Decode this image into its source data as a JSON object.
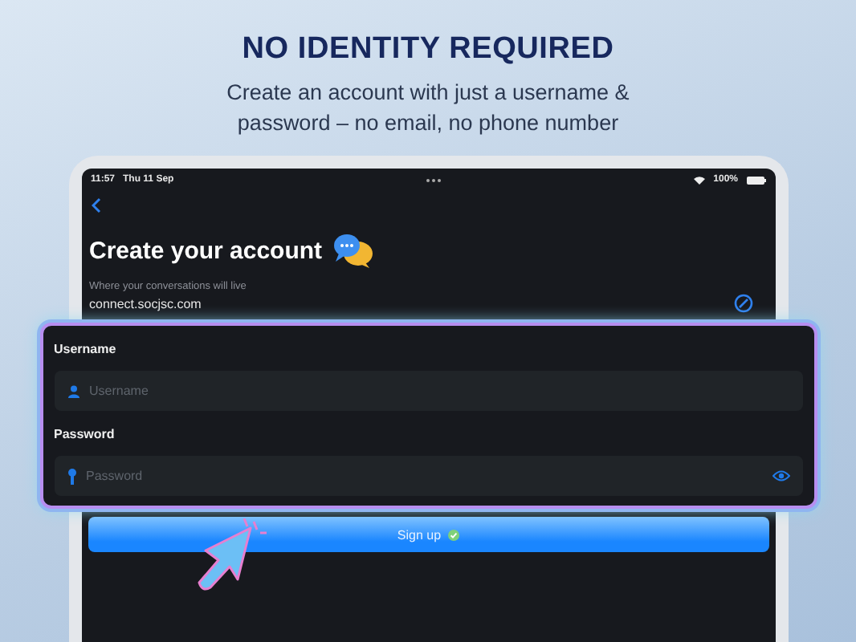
{
  "banner": {
    "headline": "NO IDENTITY REQUIRED",
    "subtitle": "Create an account with just a username & password – no email, no phone number"
  },
  "status_bar": {
    "time": "11:57",
    "date": "Thu 11 Sep",
    "battery": "100%"
  },
  "screen": {
    "title": "Create your account",
    "server_hint": "Where your conversations will live",
    "server": "connect.socjsc.com"
  },
  "fields": [
    {
      "kind": "username",
      "label": "Username",
      "placeholder": "Username"
    },
    {
      "kind": "password",
      "label": "Password",
      "placeholder": "Password"
    }
  ],
  "button": {
    "label": "Sign up"
  }
}
